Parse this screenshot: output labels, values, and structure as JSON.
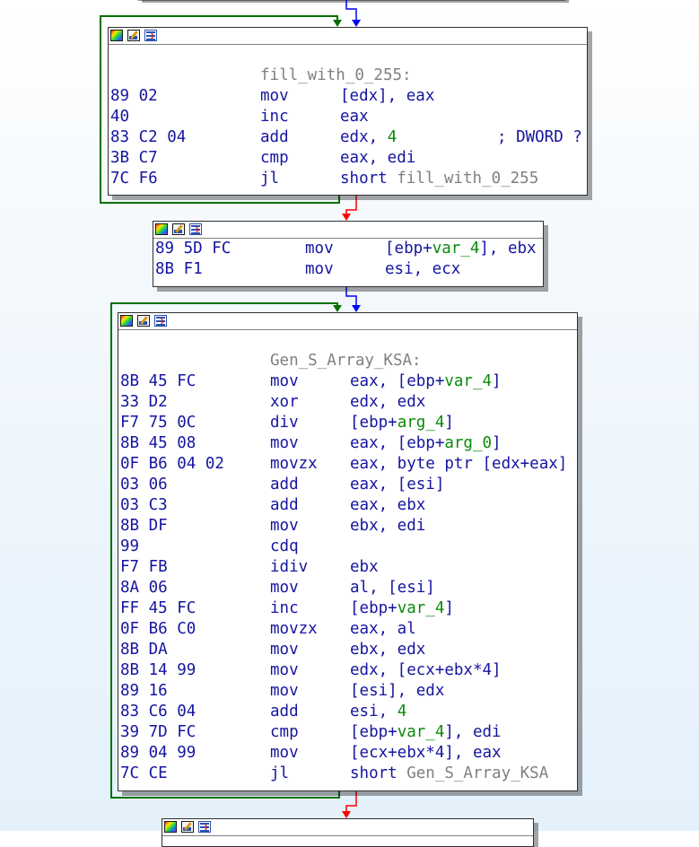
{
  "node_a": {
    "label": "fill_with_0_255:",
    "lines": [
      {
        "bytes": "89 02",
        "mnem": "mov",
        "op1": "[edx], eax"
      },
      {
        "bytes": "40",
        "mnem": "inc",
        "op1": "eax"
      },
      {
        "bytes": "83 C2 04",
        "mnem": "add",
        "op1": "edx, ",
        "num": "4",
        "cmt": "; DWORD ?"
      },
      {
        "bytes": "3B C7",
        "mnem": "cmp",
        "op1": "eax, edi"
      },
      {
        "bytes": "7C F6",
        "mnem": "jl",
        "op1": "short ",
        "ref": "fill_with_0_255"
      }
    ]
  },
  "node_b": {
    "lines": [
      {
        "bytes": "89 5D FC",
        "mnem": "mov",
        "op1": "[ebp+",
        "var": "var_4",
        "op2": "], ebx"
      },
      {
        "bytes": "8B F1",
        "mnem": "mov",
        "op1": "esi, ecx"
      }
    ]
  },
  "node_c": {
    "label": "Gen_S_Array_KSA:",
    "lines": [
      {
        "bytes": "8B 45 FC",
        "mnem": "mov",
        "op1": "eax, [ebp+",
        "var": "var_4",
        "op2": "]"
      },
      {
        "bytes": "33 D2",
        "mnem": "xor",
        "op1": "edx, edx"
      },
      {
        "bytes": "F7 75 0C",
        "mnem": "div",
        "op1": "[ebp+",
        "var": "arg_4",
        "op2": "]"
      },
      {
        "bytes": "8B 45 08",
        "mnem": "mov",
        "op1": "eax, [ebp+",
        "var": "arg_0",
        "op2": "]"
      },
      {
        "bytes": "0F B6 04 02",
        "mnem": "movzx",
        "op1": "eax, byte ptr [edx+eax]"
      },
      {
        "bytes": "03 06",
        "mnem": "add",
        "op1": "eax, [esi]"
      },
      {
        "bytes": "03 C3",
        "mnem": "add",
        "op1": "eax, ebx"
      },
      {
        "bytes": "8B DF",
        "mnem": "mov",
        "op1": "ebx, edi"
      },
      {
        "bytes": "99",
        "mnem": "cdq",
        "op1": ""
      },
      {
        "bytes": "F7 FB",
        "mnem": "idiv",
        "op1": "ebx"
      },
      {
        "bytes": "8A 06",
        "mnem": "mov",
        "op1": "al, [esi]"
      },
      {
        "bytes": "FF 45 FC",
        "mnem": "inc",
        "op1": "[ebp+",
        "var": "var_4",
        "op2": "]"
      },
      {
        "bytes": "0F B6 C0",
        "mnem": "movzx",
        "op1": "eax, al"
      },
      {
        "bytes": "8B DA",
        "mnem": "mov",
        "op1": "ebx, edx"
      },
      {
        "bytes": "8B 14 99",
        "mnem": "mov",
        "op1": "edx, [ecx+ebx*4]"
      },
      {
        "bytes": "89 16",
        "mnem": "mov",
        "op1": "[esi], edx"
      },
      {
        "bytes": "83 C6 04",
        "mnem": "add",
        "op1": "esi, ",
        "num": "4"
      },
      {
        "bytes": "39 7D FC",
        "mnem": "cmp",
        "op1": "[ebp+",
        "var": "var_4",
        "op2": "], edi"
      },
      {
        "bytes": "89 04 99",
        "mnem": "mov",
        "op1": "[ecx+ebx*4], eax"
      },
      {
        "bytes": "7C CE",
        "mnem": "jl",
        "op1": "short ",
        "ref": "Gen_S_Array_KSA"
      }
    ]
  },
  "colors": {
    "loop_edge": "#007000",
    "true_edge": "#0000ff",
    "false_edge": "#ff0000"
  }
}
